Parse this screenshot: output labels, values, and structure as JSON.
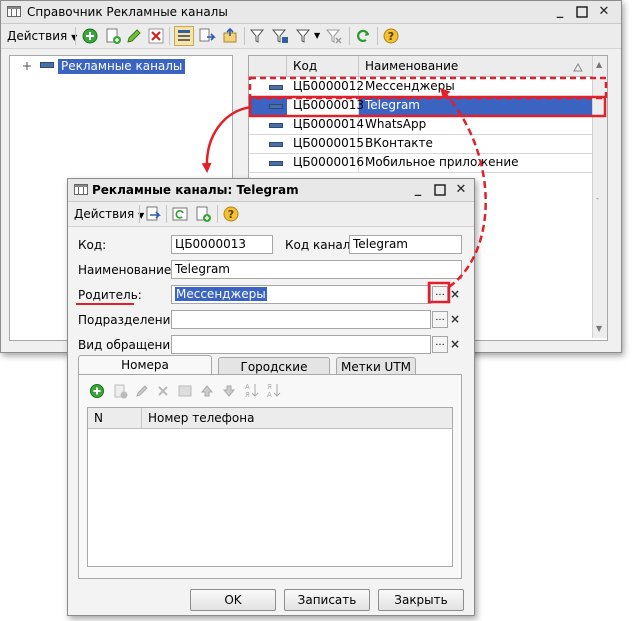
{
  "main_window": {
    "title": "Справочник Рекламные каналы",
    "toolbar": {
      "actions_label": "Действия"
    },
    "tree": {
      "root_label": "Рекламные каналы"
    },
    "grid": {
      "columns": [
        "Код",
        "Наименование"
      ],
      "rows": [
        {
          "code": "ЦБ0000012",
          "name": "Мессенджеры",
          "selected": false
        },
        {
          "code": "ЦБ0000013",
          "name": "Telegram",
          "selected": true
        },
        {
          "code": "ЦБ0000014",
          "name": "WhatsApp",
          "selected": false
        },
        {
          "code": "ЦБ0000015",
          "name": "ВКонтакте",
          "selected": false
        },
        {
          "code": "ЦБ0000016",
          "name": "Мобильное приложение",
          "selected": false
        }
      ]
    }
  },
  "dialog": {
    "title": "Рекламные каналы: Telegram",
    "toolbar": {
      "actions_label": "Действия"
    },
    "fields": {
      "code_label": "Код:",
      "code_value": "ЦБ0000013",
      "channel_code_label": "Код канала:",
      "channel_code_value": "Telegram",
      "name_label": "Наименование:",
      "name_value": "Telegram",
      "parent_label": "Родитель:",
      "parent_value": "Мессенджеры",
      "department_label": "Подразделение ...",
      "department_value": "",
      "request_type_label": "Вид обращения:",
      "request_type_value": ""
    },
    "tabs": [
      "Номера контрагентов",
      "Городские номера",
      "Метки UTM"
    ],
    "table": {
      "columns": [
        "N",
        "Номер телефона"
      ]
    },
    "buttons": {
      "ok": "OK",
      "save": "Записать",
      "close": "Закрыть"
    },
    "dots_label": "..."
  },
  "colors": {
    "selection": "#3a63c2",
    "annotation": "#e0202a",
    "window_bg": "#f0f0f0",
    "title_bg": "#e8e8e8"
  }
}
